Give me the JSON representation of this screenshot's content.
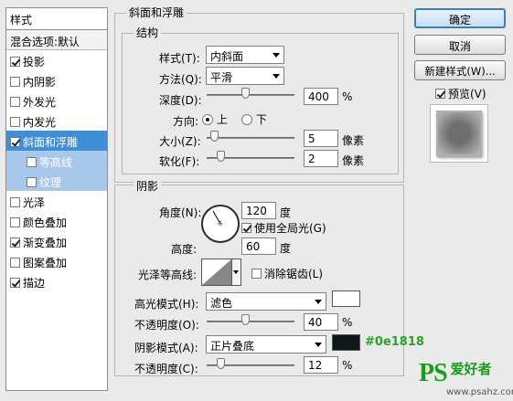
{
  "styles_panel": {
    "title": "样式",
    "blending": "混合选项:默认",
    "items": [
      {
        "label": "投影",
        "checked": true
      },
      {
        "label": "内阴影",
        "checked": false
      },
      {
        "label": "外发光",
        "checked": false
      },
      {
        "label": "内发光",
        "checked": false
      },
      {
        "label": "斜面和浮雕",
        "checked": true,
        "active": true
      },
      {
        "label": "等高线",
        "checked": false,
        "sub": true
      },
      {
        "label": "纹理",
        "checked": false,
        "sub": true
      },
      {
        "label": "光泽",
        "checked": false
      },
      {
        "label": "颜色叠加",
        "checked": false
      },
      {
        "label": "渐变叠加",
        "checked": true
      },
      {
        "label": "图案叠加",
        "checked": false
      },
      {
        "label": "描边",
        "checked": true
      }
    ]
  },
  "bevel": {
    "group_title": "斜面和浮雕",
    "structure_title": "结构",
    "style_label": "样式(T):",
    "style_value": "内斜面",
    "technique_label": "方法(Q):",
    "technique_value": "平滑",
    "depth_label": "深度(D):",
    "depth_value": "400",
    "depth_unit": "%",
    "direction_label": "方向:",
    "direction_up": "上",
    "direction_down": "下",
    "size_label": "大小(Z):",
    "size_value": "5",
    "size_unit": "像素",
    "soften_label": "软化(F):",
    "soften_value": "2",
    "soften_unit": "像素"
  },
  "shading": {
    "title": "阴影",
    "angle_label": "角度(N):",
    "angle_value": "120",
    "angle_unit": "度",
    "global_light_label": "使用全局光(G)",
    "global_light_checked": true,
    "altitude_label": "高度:",
    "altitude_value": "60",
    "altitude_unit": "度",
    "gloss_contour_label": "光泽等高线:",
    "antialiased_label": "消除锯齿(L)",
    "antialiased_checked": false,
    "highlight_mode_label": "高光模式(H):",
    "highlight_mode_value": "滤色",
    "highlight_color": "#ffffff",
    "highlight_opacity_label": "不透明度(O):",
    "highlight_opacity_value": "40",
    "shadow_mode_label": "阴影模式(A):",
    "shadow_mode_value": "正片叠底",
    "shadow_color": "#0e1818",
    "shadow_color_annotation": "#0e1818",
    "shadow_opacity_label": "不透明度(C):",
    "shadow_opacity_value": "12",
    "percent": "%"
  },
  "buttons": {
    "ok": "确定",
    "cancel": "取消",
    "new_style": "新建样式(W)...",
    "preview_label": "预览(V)",
    "preview_checked": true
  },
  "watermark": {
    "logo": "PS",
    "brand": "爱好者",
    "url": "www.psahz.com"
  },
  "levels": {
    "depth": 0.4,
    "size": 0.05,
    "soften": 0.12,
    "highlight_opacity": 0.4,
    "shadow_opacity": 0.12,
    "angle_deg": 120
  }
}
